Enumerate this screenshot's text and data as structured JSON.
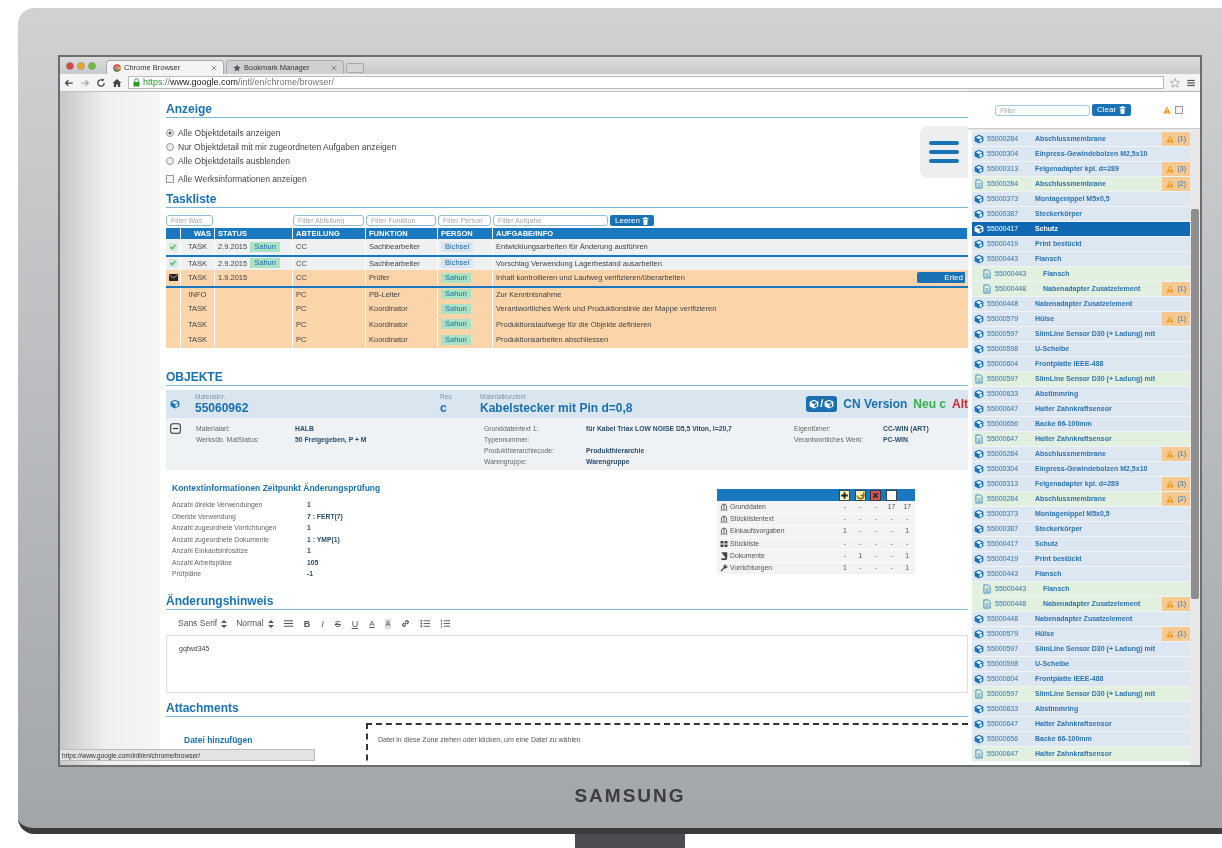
{
  "browser": {
    "tabs": [
      {
        "title": "Chrome Browser",
        "kind": "chrome",
        "selected": true
      },
      {
        "title": "Bookmark Manager",
        "kind": "star",
        "selected": false
      }
    ],
    "url": [
      {
        "text": "https",
        "kind": "scheme"
      },
      {
        "text": "://",
        "kind": "plain"
      },
      {
        "text": "www.google.com",
        "kind": "host"
      },
      {
        "text": "/intl/en/chrome/browser/",
        "kind": "plain"
      }
    ],
    "status_url": "https://www.google.com/intl/en/chrome/browser/"
  },
  "anzeige": {
    "title": "Anzeige",
    "radios": [
      {
        "label": "Alle Objektdetails anzeigen",
        "selected": true
      },
      {
        "label": "Nur Objektdetail mit mir zugeordneten Aufgaben anzeigen",
        "selected": false
      },
      {
        "label": "Alle Objektdetails ausblenden",
        "selected": false
      }
    ],
    "checkbox": {
      "label": "Alle Werksinformationen anzeigen",
      "checked": false
    }
  },
  "taskliste": {
    "title": "Taskliste",
    "filters": [
      {
        "kind": "was",
        "placeholder": "Filter Was"
      },
      {
        "kind": "abteilung",
        "placeholder": "Filter Abteilung"
      },
      {
        "kind": "funktion",
        "placeholder": "Filter Funktion"
      },
      {
        "kind": "person",
        "placeholder": "Filter Person"
      },
      {
        "kind": "aufgabe",
        "placeholder": "Filter Aufgabe"
      }
    ],
    "clear_button": "Leeren",
    "columns": [
      "WAS",
      "STATUS",
      "ABTEILUNG",
      "FUNKTION",
      "PERSON",
      "AUFGABE/INFO"
    ],
    "rows": [
      {
        "kind": "done",
        "was": "TASK",
        "date": "2.9.2015",
        "status": {
          "label": "Sahun",
          "color": "#a9e2c4"
        },
        "abteilung": "CC",
        "funktion": "Sachbearbeiter",
        "person": {
          "label": "Bichsel",
          "color": "#dbe5ef"
        },
        "info": "Entwicklungsarbeiten für Änderung ausführen",
        "highlight": false,
        "group_start": false
      },
      {
        "kind": "done",
        "was": "TASK",
        "date": "2.9.2015",
        "status": {
          "label": "Sahun",
          "color": "#a9e2c4"
        },
        "abteilung": "CC",
        "funktion": "Sachbearbeiter",
        "person": {
          "label": "Bichsel",
          "color": "#dbe5ef"
        },
        "info": "Vorschlag Verwendung Lagerbestand ausarbeiten",
        "highlight": false,
        "group_start": true
      },
      {
        "kind": "message",
        "was": "TASK",
        "date": "1.9.2015",
        "abteilung": "CC",
        "funktion": "Prüfer",
        "person": {
          "label": "Sahun",
          "color": "#a9e2c4"
        },
        "info": "Inhalt kontrollieren und Laufweg verifizieren/überarbeiten",
        "action": "Erled",
        "highlight": true,
        "group_start": false
      },
      {
        "kind": "plain",
        "was": "INFO",
        "abteilung": "PC",
        "funktion": "PB-Leiter",
        "person": {
          "label": "Sahun",
          "color": "#a9e2c4"
        },
        "info": "Zur Kenntnisnahme",
        "highlight": true,
        "group_start": true
      },
      {
        "kind": "plain",
        "was": "TASK",
        "abteilung": "PC",
        "funktion": "Koordinator",
        "person": {
          "label": "Sahun",
          "color": "#a9e2c4"
        },
        "info": "Verantwortliches Werk und Produktionslinie der Mappe verifizieren",
        "highlight": true,
        "group_start": false
      },
      {
        "kind": "plain",
        "was": "TASK",
        "abteilung": "PC",
        "funktion": "Koordinator",
        "person": {
          "label": "Sahun",
          "color": "#a9e2c4"
        },
        "info": "Produktionslaufwege für die Objekte definieren",
        "highlight": true,
        "group_start": false
      },
      {
        "kind": "plain",
        "was": "TASK",
        "abteilung": "PC",
        "funktion": "Koordinator",
        "person": {
          "label": "Sahun",
          "color": "#a9e2c4"
        },
        "info": "Produktionsarbeiten abschliessen",
        "highlight": true,
        "group_start": false
      }
    ]
  },
  "objekte": {
    "title": "OBJEKTE",
    "header": {
      "materialnr": {
        "label": "Materialnr.",
        "value": "55060962"
      },
      "rev": {
        "label": "Rev.",
        "value": "c"
      },
      "kurztext": {
        "label": "Materialkurztext",
        "value": "Kabelstecker mit Pin d=0,8"
      },
      "switch_separator": "/",
      "versions": [
        {
          "label": "CN Version",
          "color": "#1a6fb0"
        },
        {
          "label": "Neu c",
          "color": "#3aae48"
        },
        {
          "label": "Alt",
          "color": "#d9262c"
        }
      ]
    },
    "details": {
      "expanded": true,
      "groups": [
        [
          {
            "label": "Materialart:",
            "value": "HALB"
          },
          {
            "label": "Werksüb. MatStatus:",
            "value": "50 Freigegeben, P + M"
          }
        ],
        [
          {
            "label": "Grunddatentext 1:",
            "value": "für Kabel Triax LOW NOISE D5,5 Viton, l=20,7"
          },
          {
            "label": "Typennummer:"
          },
          {
            "label": "Produkthierarchiecode:",
            "value": "Produkthierarchie"
          },
          {
            "label": "Warengruppe:",
            "value": "Warengruppe"
          }
        ],
        [
          {
            "label": "Eigentümer:",
            "value": "CC-WIN (ART)"
          },
          {
            "label": "Verantwortliches Werk:",
            "value": "PC-WIN"
          }
        ]
      ]
    }
  },
  "kontext": {
    "title": "Kontextinformationen Zeitpunkt Änderungsprüfung",
    "pairs": [
      {
        "label": "Anzahl direkte Verwendungen",
        "value": "1"
      },
      {
        "label": "Oberste Verwendung",
        "value": "7 : FERT(7)"
      },
      {
        "label": "Anzahl zugeordnete Vorrichtungen",
        "value": "1"
      },
      {
        "label": "Anzahl zugeordnete Dokumente",
        "value": "1 : YMP(1)"
      },
      {
        "label": "Anzahl Einkaufsinfosätze",
        "value": "1"
      },
      {
        "label": "Anzahl Arbeitspläne",
        "value": "105"
      },
      {
        "label": "Prüfpläne",
        "value": "-1"
      }
    ],
    "stats": {
      "rows": [
        {
          "kind": "bank",
          "label": "Grunddaten",
          "values": [
            "-",
            "-",
            "-",
            "17",
            "17"
          ]
        },
        {
          "kind": "bank",
          "label": "Stücklistentext",
          "values": [
            "-",
            "-",
            "-",
            "-",
            "-"
          ]
        },
        {
          "kind": "bank",
          "label": "Einkaufsvorgaben",
          "values": [
            "1",
            "-",
            "-",
            "-",
            "1"
          ]
        },
        {
          "kind": "grid",
          "label": "Stückliste",
          "values": [
            "-",
            "-",
            "-",
            "-",
            "-"
          ]
        },
        {
          "kind": "book",
          "label": "Dokumente",
          "values": [
            "-",
            "1",
            "-",
            "-",
            "1"
          ]
        },
        {
          "kind": "wrench",
          "label": "Vorrichtungen",
          "values": [
            "1",
            "-",
            "-",
            "-",
            "1"
          ]
        }
      ]
    }
  },
  "editor": {
    "title": "Änderungshinweis",
    "toolbar": [
      {
        "kind": "select",
        "label": "Sans Serif"
      },
      {
        "kind": "select",
        "label": "Normal"
      },
      {
        "kind": "lines"
      },
      {
        "kind": "bold",
        "label": "B"
      },
      {
        "kind": "italic",
        "label": "I"
      },
      {
        "kind": "strike",
        "label": "S"
      },
      {
        "kind": "underline",
        "label": "U"
      },
      {
        "kind": "color",
        "label": "A"
      },
      {
        "kind": "background",
        "label": "A"
      },
      {
        "kind": "link"
      },
      {
        "kind": "bullets"
      },
      {
        "kind": "numbers"
      }
    ],
    "content": "gqfwd345"
  },
  "attachments": {
    "title": "Attachments",
    "add_label": "Datei hinzufügen",
    "dropzone": "Datei in diese Zone ziehen oder klicken, um eine Datei zu wählen"
  },
  "panel": {
    "filter_placeholder": "Filter",
    "clear_button": "Clear",
    "warning_only": false,
    "items": [
      {
        "kind": "cube",
        "number": "55000284",
        "name": "Abschlussmembrane",
        "warning": "(1)",
        "selected": false
      },
      {
        "kind": "cube",
        "number": "55000304",
        "name": "Einpress-Gewindebolzen M2,5x10",
        "selected": false
      },
      {
        "kind": "cube",
        "number": "55000313",
        "name": "Felgenadapter kpl. d=289",
        "warning": "(3)",
        "selected": false
      },
      {
        "kind": "document",
        "number": "55000284",
        "name": "Abschlussmembrane",
        "warning": "(2)",
        "selected": false
      },
      {
        "kind": "cube",
        "number": "55000373",
        "name": "Montagenippel M5x0,5",
        "selected": false
      },
      {
        "kind": "cube",
        "number": "55000387",
        "name": "Steckerkörper",
        "selected": false
      },
      {
        "kind": "cube",
        "number": "55000417",
        "name": "Schutz",
        "selected": true
      },
      {
        "kind": "cube",
        "number": "55000419",
        "name": "Print bestückt",
        "selected": false
      },
      {
        "kind": "cube",
        "number": "55000443",
        "name": "Flansch",
        "selected": false,
        "children": [
          {
            "kind": "document",
            "number": "55000443",
            "name": "Flansch",
            "selected": false
          },
          {
            "kind": "document",
            "number": "55000448",
            "name": "Nabenadapter Zusatzelement",
            "warning": "(1)",
            "selected": false
          }
        ]
      },
      {
        "kind": "cube",
        "number": "55000448",
        "name": "Nabenadapter Zusatzelement",
        "selected": false
      },
      {
        "kind": "cube",
        "number": "55000579",
        "name": "Hülse",
        "warning": "(1)",
        "selected": false
      },
      {
        "kind": "cube",
        "number": "55000597",
        "name": "SlimLine Sensor D30 (+ Ladung)  mit",
        "selected": false
      },
      {
        "kind": "cube",
        "number": "55000598",
        "name": "U-Scheibe",
        "selected": false
      },
      {
        "kind": "cube",
        "number": "55000604",
        "name": "Frontplatte IEEE-488",
        "selected": false
      },
      {
        "kind": "document",
        "number": "55000597",
        "name": "SlimLine Sensor D30 (+ Ladung)  mit",
        "selected": false
      },
      {
        "kind": "cube",
        "number": "55000633",
        "name": "Abstimmring",
        "selected": false
      },
      {
        "kind": "cube",
        "number": "55000647",
        "name": "Halter Zahnkraftsensor",
        "selected": false
      },
      {
        "kind": "cube",
        "number": "55000656",
        "name": "Backe 66-100mm",
        "selected": false
      },
      {
        "kind": "document",
        "number": "55000647",
        "name": "Halter Zahnkraftsensor",
        "selected": false
      },
      {
        "kind": "cube",
        "number": "55000284",
        "name": "Abschlussmembrane",
        "warning": "(1)",
        "selected": false
      },
      {
        "kind": "cube",
        "number": "55000304",
        "name": "Einpress-Gewindebolzen M2,5x10",
        "selected": false
      },
      {
        "kind": "cube",
        "number": "55000313",
        "name": "Felgenadapter kpl. d=289",
        "warning": "(3)",
        "selected": false
      },
      {
        "kind": "document",
        "number": "55000284",
        "name": "Abschlussmembrane",
        "warning": "(2)",
        "selected": false
      },
      {
        "kind": "cube",
        "number": "55000373",
        "name": "Montagenippel M5x0,5",
        "selected": false
      },
      {
        "kind": "cube",
        "number": "55000387",
        "name": "Steckerkörper",
        "selected": false
      },
      {
        "kind": "cube",
        "number": "55000417",
        "name": "Schutz",
        "selected": false
      },
      {
        "kind": "cube",
        "number": "55000419",
        "name": "Print bestückt",
        "selected": false
      },
      {
        "kind": "cube",
        "number": "55000443",
        "name": "Flansch",
        "selected": false,
        "children": [
          {
            "kind": "document",
            "number": "55000443",
            "name": "Flansch",
            "selected": false
          },
          {
            "kind": "document",
            "number": "55000448",
            "name": "Nabenadapter Zusatzelement",
            "warning": "(1)",
            "selected": false
          }
        ]
      },
      {
        "kind": "cube",
        "number": "55000448",
        "name": "Nabenadapter Zusatzelement",
        "selected": false
      },
      {
        "kind": "cube",
        "number": "55000579",
        "name": "Hülse",
        "warning": "(1)",
        "selected": false
      },
      {
        "kind": "cube",
        "number": "55000597",
        "name": "SlimLine Sensor D30 (+ Ladung)  mit",
        "selected": false
      },
      {
        "kind": "cube",
        "number": "55000598",
        "name": "U-Scheibe",
        "selected": false
      },
      {
        "kind": "cube",
        "number": "55000604",
        "name": "Frontplatte IEEE-488",
        "selected": false
      },
      {
        "kind": "document",
        "number": "55000597",
        "name": "SlimLine Sensor D30 (+ Ladung)  mit",
        "selected": false
      },
      {
        "kind": "cube",
        "number": "55000633",
        "name": "Abstimmring",
        "selected": false
      },
      {
        "kind": "cube",
        "number": "55000647",
        "name": "Halter Zahnkraftsensor",
        "selected": false
      },
      {
        "kind": "cube",
        "number": "55000656",
        "name": "Backe 66-100mm",
        "selected": false
      },
      {
        "kind": "document",
        "number": "55000647",
        "name": "Halter Zahnkraftsensor",
        "selected": false
      }
    ]
  },
  "monitor": {
    "brand": "SAMSUNG"
  }
}
